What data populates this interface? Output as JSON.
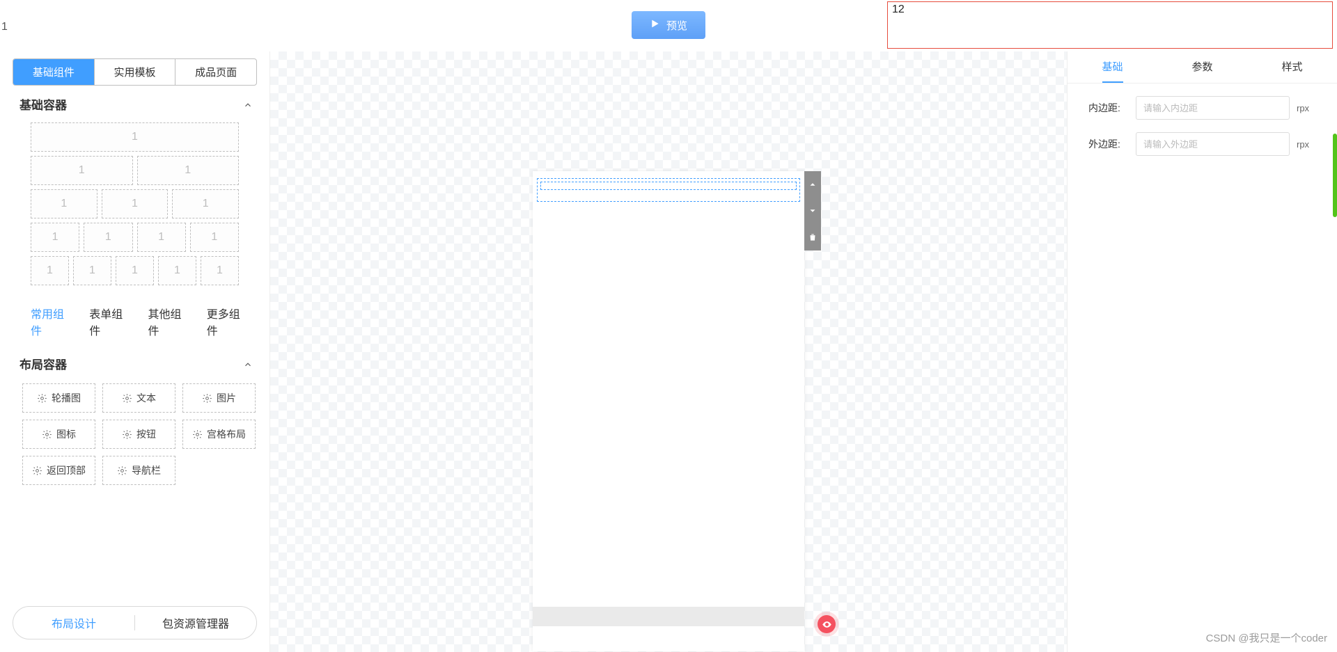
{
  "header": {
    "left_number": "1",
    "preview": "预览",
    "red_box_text": "12"
  },
  "left": {
    "tabs": [
      "基础组件",
      "实用模板",
      "成品页面"
    ],
    "active_tab": 0,
    "section_containers": "基础容器",
    "layout_cell": "1",
    "sub_tabs": [
      "常用组件",
      "表单组件",
      "其他组件",
      "更多组件"
    ],
    "active_sub_tab": 0,
    "section_layout": "布局容器",
    "components": [
      "轮播图",
      "文本",
      "图片",
      "图标",
      "按钮",
      "宫格布局",
      "返回顶部",
      "导航栏"
    ],
    "bottom": {
      "left": "布局设计",
      "right": "包资源管理器"
    }
  },
  "right": {
    "tabs": [
      "基础",
      "参数",
      "样式"
    ],
    "active_tab": 0,
    "padding_label": "内边距:",
    "padding_placeholder": "请输入内边距",
    "margin_label": "外边距:",
    "margin_placeholder": "请输入外边距",
    "unit": "rpx"
  },
  "watermark": "CSDN @我只是一个coder"
}
